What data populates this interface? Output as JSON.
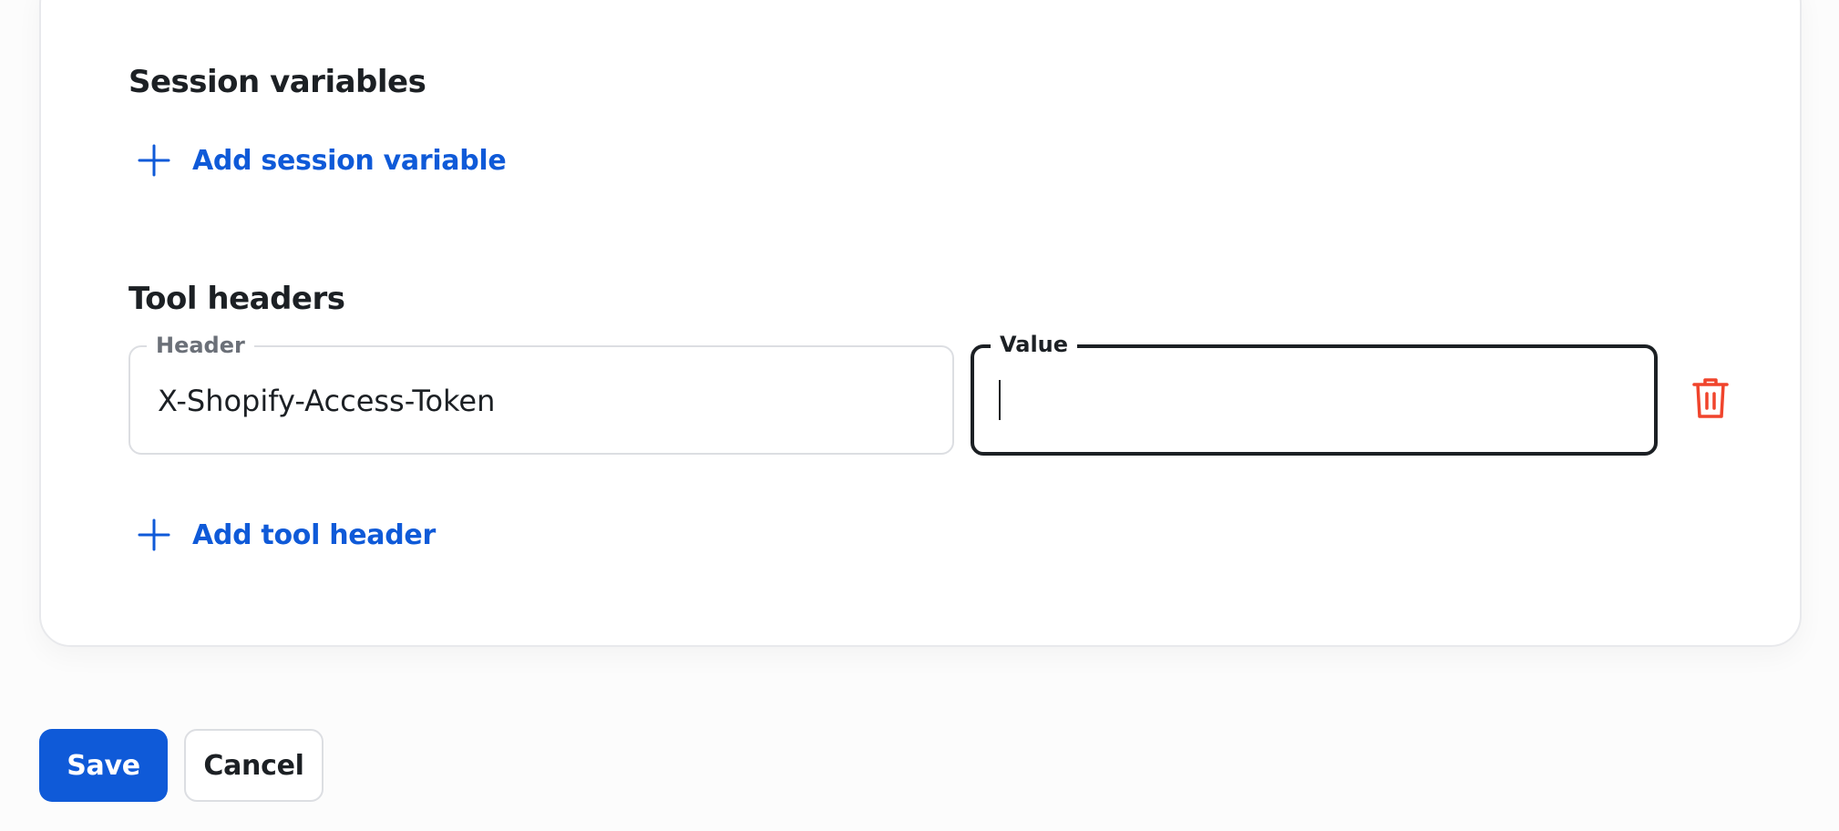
{
  "session_variables": {
    "title": "Session variables",
    "add_label": "Add session variable"
  },
  "tool_headers": {
    "title": "Tool headers",
    "rows": [
      {
        "header_label": "Header",
        "header_value": "X-Shopify-Access-Token",
        "value_label": "Value",
        "value_value": ""
      }
    ],
    "add_label": "Add tool header"
  },
  "actions": {
    "save_label": "Save",
    "cancel_label": "Cancel"
  },
  "colors": {
    "accent": "#0f5ad8",
    "danger": "#f0442c",
    "text": "#1c2024"
  },
  "icons": {
    "add": "plus-icon",
    "delete": "trash-icon"
  }
}
